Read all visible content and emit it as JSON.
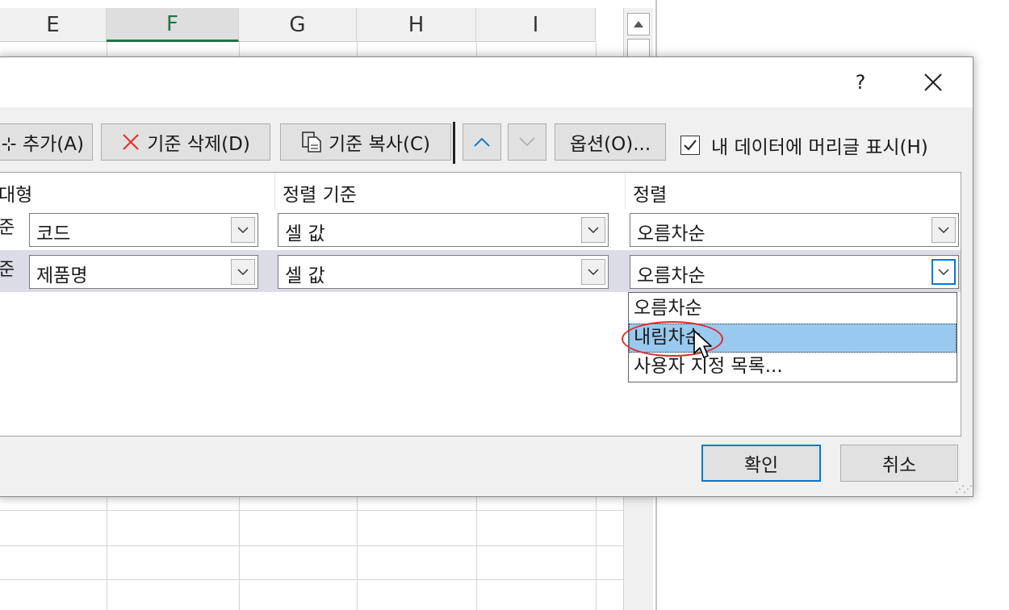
{
  "sheet": {
    "columns": [
      "E",
      "F",
      "G",
      "H",
      "I"
    ],
    "selected_column": "F"
  },
  "dialog": {
    "help_label": "?",
    "toolbar": {
      "add_label": "⊹ 추가(A)",
      "delete_label": "기준 삭제(D)",
      "copy_label": "기준 복사(C)",
      "options_label": "옵션(O)...",
      "header_checkbox_label": "내 데이터에 머리글 표시(H)",
      "header_checkbox_checked": true
    },
    "grid": {
      "headers": [
        "대형",
        "정렬 기준",
        "정렬"
      ],
      "rows": [
        {
          "label": "준",
          "column": "코드",
          "sort_on": "셀 값",
          "order": "오름차순"
        },
        {
          "label": "준",
          "column": "제품명",
          "sort_on": "셀 값",
          "order": "오름차순"
        }
      ]
    },
    "dropdown": {
      "options": [
        "오름차순",
        "내림차순",
        "사용자 지정 목록..."
      ],
      "selected": "내림차순"
    },
    "buttons": {
      "ok": "확인",
      "cancel": "취소"
    }
  },
  "colors": {
    "accent": "#0078d7",
    "excel_green": "#217346",
    "highlight_ring": "#e02a2a",
    "selected_option": "#99c9ef"
  }
}
